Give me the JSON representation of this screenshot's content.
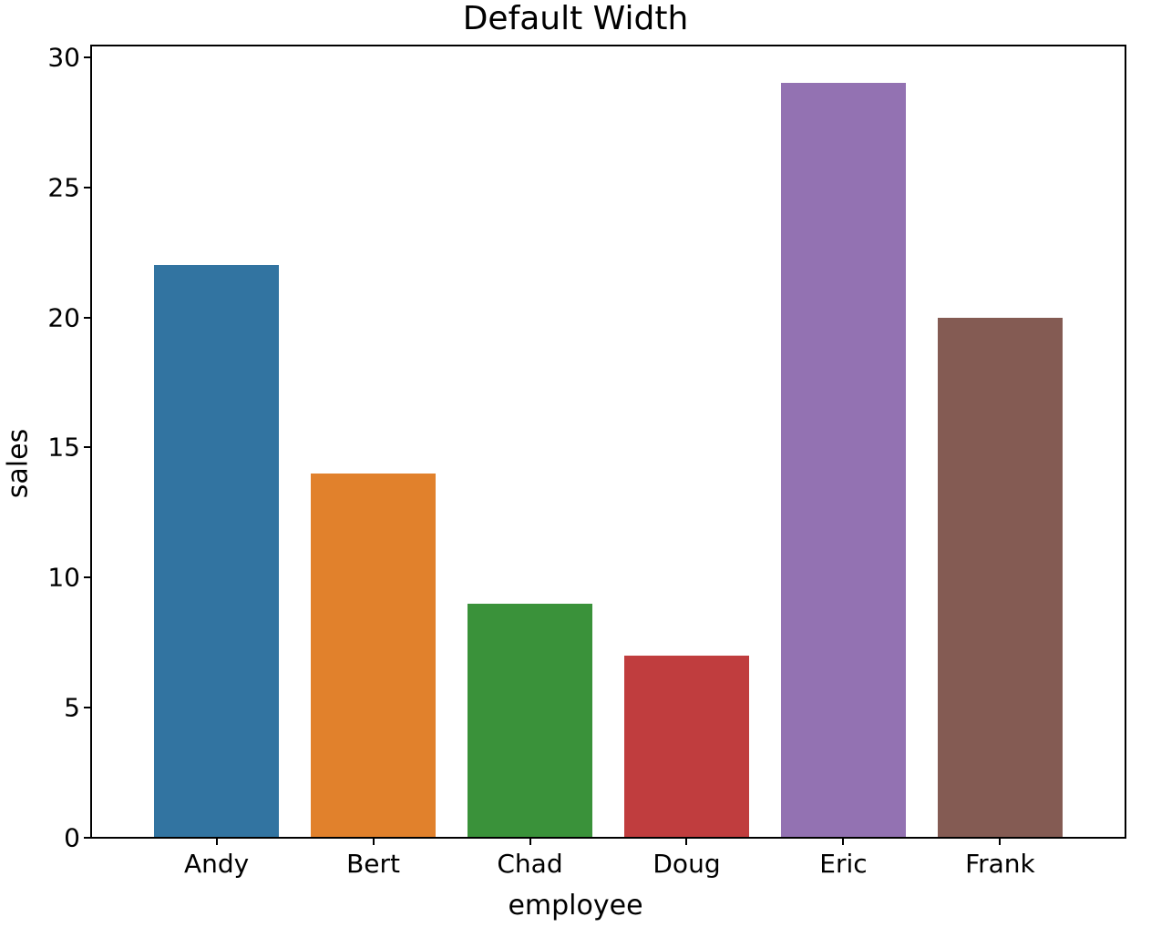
{
  "chart_data": {
    "type": "bar",
    "title": "Default Width",
    "xlabel": "employee",
    "ylabel": "sales",
    "categories": [
      "Andy",
      "Bert",
      "Chad",
      "Doug",
      "Eric",
      "Frank"
    ],
    "values": [
      22,
      14,
      9,
      7,
      29,
      20
    ],
    "yticks": [
      0,
      5,
      10,
      15,
      20,
      25,
      30
    ],
    "ylim": [
      0,
      30.45
    ],
    "colors": [
      "#3274a1",
      "#e1812c",
      "#3a923a",
      "#c03d3e",
      "#9372b2",
      "#845b53"
    ]
  }
}
